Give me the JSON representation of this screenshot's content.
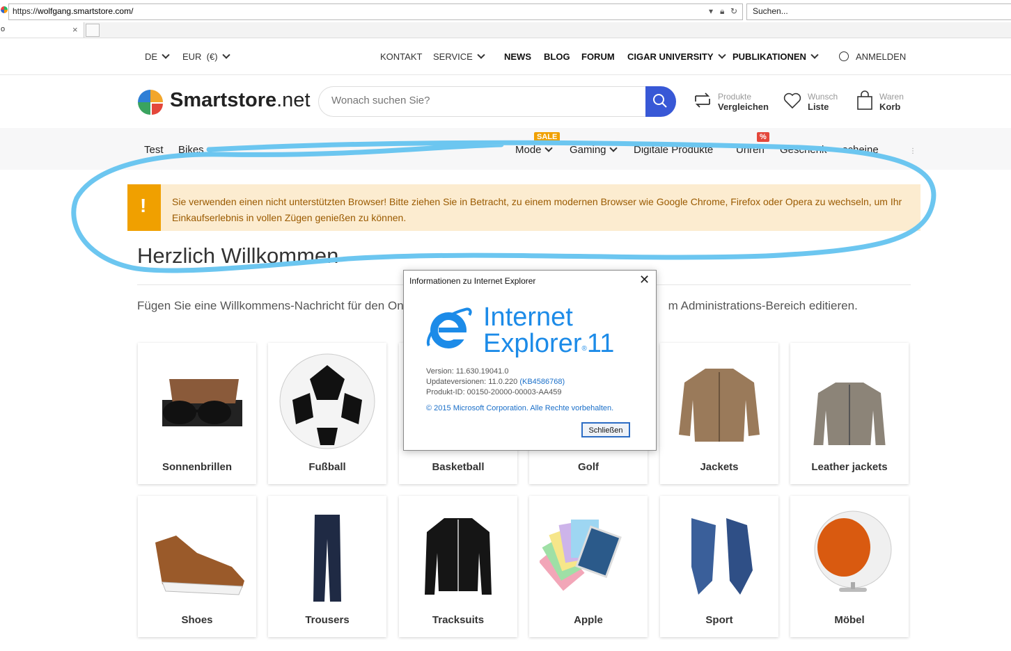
{
  "browser": {
    "url_prefix": "https://",
    "url_host": "wolfgang.smartstore.com/",
    "search_placeholder": "Suchen...",
    "tab_label": "o"
  },
  "topbar": {
    "language": "DE",
    "currency": "EUR  (€)",
    "links": [
      "KONTAKT",
      "SERVICE",
      "NEWS",
      "BLOG",
      "FORUM",
      "CIGAR UNIVERSITY",
      "PUBLIKATIONEN"
    ],
    "login": "ANMELDEN"
  },
  "header": {
    "logo_bold": "Smartstore",
    "logo_light": ".net",
    "search_placeholder": "Wonach suchen Sie?",
    "compare_top": "Produkte",
    "compare_bottom": "Vergleichen",
    "wishlist_top": "Wunsch",
    "wishlist_bottom": "Liste",
    "cart_top": "Waren",
    "cart_bottom": "Korb"
  },
  "categories": {
    "items": [
      "Test",
      "Bikes",
      "Mode",
      "Gaming",
      "Digitale Produkte",
      "Uhren",
      "Geschenk",
      "scheine"
    ],
    "sale_badge": "SALE",
    "percent_badge": "%"
  },
  "alert": {
    "icon": "!",
    "message": "Sie verwenden einen nicht unterstützten Browser! Bitte ziehen Sie in Betracht, zu einem modernen Browser wie Google Chrome, Firefox oder Opera zu wechseln, um Ihr Einkaufserlebnis in vollen Zügen genießen zu können."
  },
  "main": {
    "welcome": "Herzlich Willkommen",
    "intro_left": "Fügen Sie eine Willkommens-Nachricht für den On",
    "intro_right": "m Administrations-Bereich editieren."
  },
  "tiles": [
    "Sonnenbrillen",
    "Fußball",
    "Basketball",
    "Golf",
    "Jackets",
    "Leather jackets",
    "Shoes",
    "Trousers",
    "Tracksuits",
    "Apple",
    "Sport",
    "Möbel"
  ],
  "dialog": {
    "title": "Informationen zu Internet Explorer",
    "product_line1": "Internet",
    "product_line2": "Explorer",
    "product_version": "11",
    "version": "Version: 11.630.19041.0",
    "update_label": "Updateversionen: 11.0.220 ",
    "update_kb": "(KB4586768)",
    "product_id": "Produkt-ID: 00150-20000-00003-AA459",
    "copyright": "© 2015 Microsoft Corporation. Alle Rechte vorbehalten.",
    "close_button": "Schließen"
  },
  "colors": {
    "accent_blue": "#3858d6",
    "alert_orange": "#f0a000",
    "alert_bg": "#fcecd0",
    "annotation": "#6cc6f0",
    "ie_blue": "#1c8be8"
  }
}
